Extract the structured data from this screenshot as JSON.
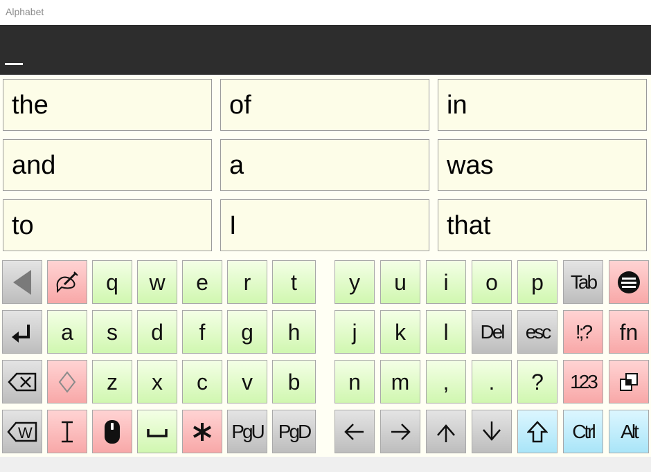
{
  "window": {
    "title": "Alphabet"
  },
  "text_area": {
    "content": ""
  },
  "predictions": [
    [
      "the",
      "of",
      "in"
    ],
    [
      "and",
      "a",
      "was"
    ],
    [
      "to",
      "I",
      "that"
    ]
  ],
  "keyboard": {
    "row1": {
      "letters_left": [
        "q",
        "w",
        "e",
        "r",
        "t"
      ],
      "letters_right": [
        "y",
        "u",
        "i",
        "o",
        "p"
      ],
      "tab": "Tab"
    },
    "row2": {
      "letters_left": [
        "a",
        "s",
        "d",
        "f",
        "g",
        "h"
      ],
      "letters_right": [
        "j",
        "k",
        "l"
      ],
      "del": "Del",
      "esc": "esc",
      "punct": "!;?",
      "fn": "fn"
    },
    "row3": {
      "letters_left": [
        "z",
        "x",
        "c",
        "v",
        "b"
      ],
      "letters_right": [
        "n",
        "m",
        ",",
        ".",
        "?"
      ],
      "numbers": "123"
    },
    "row4": {
      "pgup": "PgU",
      "pgdn": "PgD",
      "ctrl": "Ctrl",
      "alt": "Alt"
    }
  },
  "colors": {
    "letter_key": "#d8f8bc",
    "function_key": "#f8b4b4",
    "gray_key": "#c8c8c8",
    "modifier_key": "#b4eafa",
    "text_bar": "#2d2d2d",
    "prediction_bg": "#fdfde8"
  }
}
